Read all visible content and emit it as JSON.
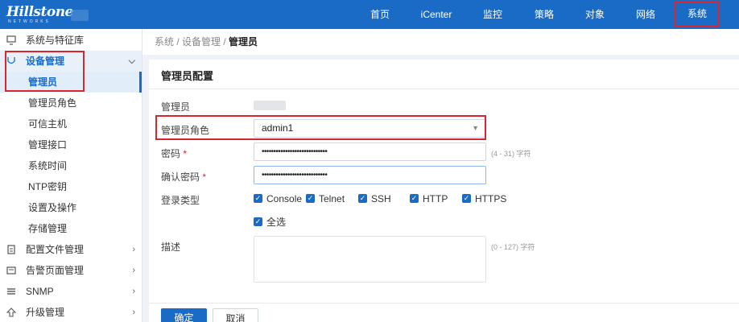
{
  "header": {
    "logo_text": "Hillstone",
    "logo_sub": "NETWORKS",
    "nav": [
      "首页",
      "iCenter",
      "监控",
      "策略",
      "对象",
      "网络",
      "系统"
    ]
  },
  "sidebar": {
    "groups": [
      {
        "label": "系统与特征库"
      },
      {
        "label": "设备管理"
      },
      {
        "label": "配置文件管理"
      },
      {
        "label": "告警页面管理"
      },
      {
        "label": "SNMP"
      },
      {
        "label": "升级管理"
      }
    ],
    "sub_items": [
      "管理员",
      "管理员角色",
      "可信主机",
      "管理接口",
      "系统时间",
      "NTP密钥",
      "设置及操作",
      "存储管理"
    ]
  },
  "breadcrumb": {
    "path": "系统 / 设备管理 / ",
    "current": "管理员"
  },
  "form": {
    "title": "管理员配置",
    "labels": {
      "admin": "管理员",
      "role": "管理员角色",
      "password": "密码",
      "confirm": "确认密码",
      "login_type": "登录类型",
      "desc": "描述"
    },
    "required_mark": "*",
    "role_value": "admin1",
    "password_value": "••••••••••••••••••••••••••••",
    "confirm_value": "••••••••••••••••••••••••••••",
    "password_hint": "(4 - 31) 字符",
    "desc_hint": "(0 - 127) 字符",
    "login_types": [
      "Console",
      "Telnet",
      "SSH",
      "HTTP",
      "HTTPS"
    ],
    "select_all": "全选",
    "check_mark": "✓",
    "ok_button": "确定",
    "cancel_button": "取消"
  },
  "colors": {
    "brand": "#1a6bc6",
    "highlight": "#d7262d"
  }
}
